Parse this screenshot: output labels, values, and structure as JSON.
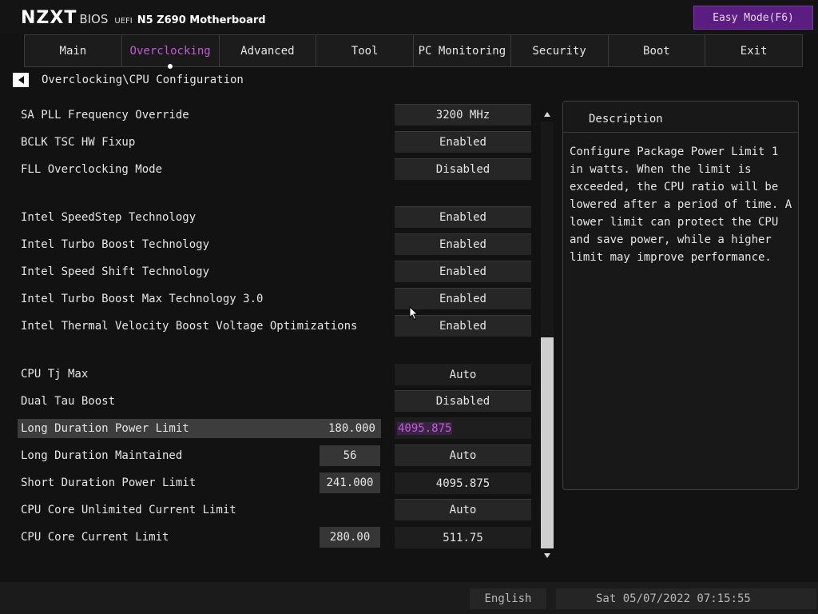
{
  "header": {
    "brand": "NZXT",
    "bios": "BIOS",
    "uefi": "UEFI",
    "model": "N5 Z690 Motherboard",
    "easy_mode": "Easy Mode(F6)"
  },
  "tabs": [
    {
      "label": "Main",
      "active": false
    },
    {
      "label": "Overclocking",
      "active": true
    },
    {
      "label": "Advanced",
      "active": false
    },
    {
      "label": "Tool",
      "active": false
    },
    {
      "label": "PC Monitoring",
      "active": false
    },
    {
      "label": "Security",
      "active": false
    },
    {
      "label": "Boot",
      "active": false
    },
    {
      "label": "Exit",
      "active": false
    }
  ],
  "breadcrumb": "Overclocking\\CPU Configuration",
  "settings": [
    {
      "label": "SA PLL Frequency Override",
      "value": "3200 MHz"
    },
    {
      "label": "BCLK TSC HW Fixup",
      "value": "Enabled"
    },
    {
      "label": "FLL Overclocking Mode",
      "value": "Disabled"
    },
    {
      "label": "Intel SpeedStep Technology",
      "value": "Enabled"
    },
    {
      "label": "Intel Turbo Boost Technology",
      "value": "Enabled"
    },
    {
      "label": "Intel Speed Shift Technology",
      "value": "Enabled"
    },
    {
      "label": "Intel Turbo Boost Max Technology 3.0",
      "value": "Enabled"
    },
    {
      "label": "Intel Thermal Velocity Boost Voltage Optimizations",
      "value": "Enabled"
    },
    {
      "label": "CPU Tj Max",
      "value": "Auto"
    },
    {
      "label": "Dual Tau Boost",
      "value": "Disabled"
    },
    {
      "label": "Long Duration Power Limit",
      "input": "180.000",
      "value": "4095.875"
    },
    {
      "label": "Long Duration Maintained",
      "input": "56",
      "value": "Auto"
    },
    {
      "label": "Short Duration Power Limit",
      "input": "241.000",
      "value": "4095.875"
    },
    {
      "label": "CPU Core Unlimited Current Limit",
      "value": "Auto"
    },
    {
      "label": "CPU Core Current Limit",
      "input": "280.00",
      "value": "511.75"
    }
  ],
  "description": {
    "title": "Description",
    "text": "Configure Package Power Limit 1 in watts. When the limit is exceeded, the CPU ratio will be lowered after a period of time. A lower limit can protect the CPU and save power, while a higher limit may improve performance."
  },
  "footer": {
    "language": "English",
    "datetime": "Sat 05/07/2022 07:15:55"
  },
  "colors": {
    "accent": "#c15bd6",
    "easy_mode_bg": "#5b1d82"
  }
}
